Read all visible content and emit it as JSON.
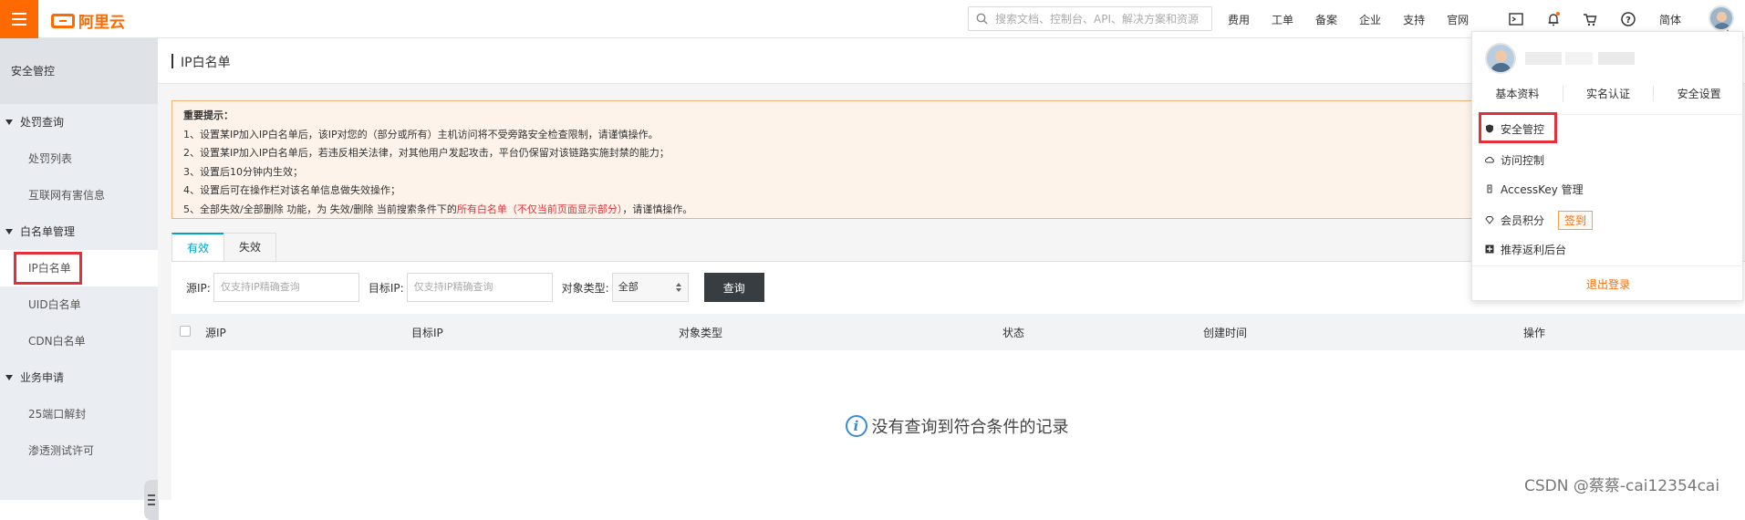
{
  "brand": {
    "logo_text": "阿里云",
    "accent": "#ff6a00"
  },
  "topbar": {
    "search_placeholder": "搜索文档、控制台、API、解决方案和资源",
    "links": [
      "费用",
      "工单",
      "备案",
      "企业",
      "支持",
      "官网"
    ],
    "icons": [
      "terminal-icon",
      "bell-icon",
      "cart-icon",
      "help-icon"
    ],
    "language": "简体"
  },
  "sidebar": {
    "title": "安全管控",
    "groups": [
      {
        "label": "处罚查询",
        "items": [
          "处罚列表",
          "互联网有害信息"
        ]
      },
      {
        "label": "白名单管理",
        "items": [
          "IP白名单",
          "UID白名单",
          "CDN白名单"
        ]
      },
      {
        "label": "业务申请",
        "items": [
          "25端口解封",
          "渗透测试许可"
        ]
      }
    ],
    "active_item": "IP白名单"
  },
  "page": {
    "title": "IP白名单",
    "notice": {
      "heading": "重要提示：",
      "lines": [
        "1、设置某IP加入IP白名单后，该IP对您的（部分或所有）主机访问将不受旁路安全检查限制，请谨慎操作。",
        "2、设置某IP加入IP白名单后，若违反相关法律，对其他用户发起攻击，平台仍保留对该链路实施封禁的能力；",
        "3、设置后10分钟内生效；",
        "4、设置后可在操作栏对该名单信息做失效操作；"
      ],
      "line5_prefix": "5、全部失效/全部删除 功能，为 失效/删除 当前搜索条件下的",
      "line5_highlight": "所有白名单（不仅当前页面显示部分）",
      "line5_suffix": "，请谨慎操作。"
    },
    "tabs": [
      "有效",
      "失效"
    ],
    "filters": {
      "source_ip_label": "源IP:",
      "source_ip_placeholder": "仅支持IP精确查询",
      "target_ip_label": "目标IP:",
      "target_ip_placeholder": "仅支持IP精确查询",
      "object_type_label": "对象类型:",
      "object_type_value": "全部",
      "query_button": "查询"
    },
    "table_headers": [
      "源IP",
      "目标IP",
      "对象类型",
      "状态",
      "创建时间",
      "操作"
    ],
    "empty_text": "没有查询到符合条件的记录"
  },
  "user_menu": {
    "tabs": [
      "基本资料",
      "实名认证",
      "安全设置"
    ],
    "items": [
      "安全管控",
      "访问控制",
      "AccessKey 管理",
      "会员积分",
      "推荐返利后台"
    ],
    "signin_badge": "签到",
    "logout": "退出登录"
  },
  "watermark": "CSDN @蔡蔡-cai12354cai"
}
